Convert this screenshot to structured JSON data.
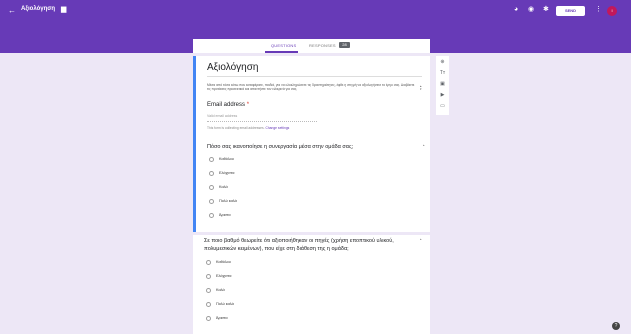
{
  "header": {
    "back_icon": "arrow-back-icon",
    "title": "Αξιολόγηση",
    "folder_icon": "folder-icon",
    "palette_icon": "palette-icon",
    "preview_icon": "eye-icon",
    "settings_icon": "gear-icon",
    "send_label": "SEND",
    "more_icon": "more-vert-icon",
    "avatar_letter": "Ι",
    "accent_color": "#673ab7"
  },
  "tabs": {
    "questions_label": "QUESTIONS",
    "responses_label": "RESPONSES",
    "responses_count": "28"
  },
  "form": {
    "title": "Αξιολόγηση",
    "description": "Μέσα από τόσα κάτω που καταφέρατε, παιδιά, για να ολοκληρώσετε τις δραστηριότητες, έφθε η στιγμή να αξιολογήσετε το έργο σας. Διαβάστε τις προτάσεις προσεκτικά και απαντήστε τον ειλικρινά για σας.",
    "email_label": "Email address",
    "email_required": "*",
    "email_placeholder": "Valid email address",
    "email_note": "This form is collecting email addresses.",
    "email_link": "Change settings"
  },
  "questions": [
    {
      "text": "Πόσο σας ικανοποίησε η συνεργασία μέσα στην ομάδα σας;",
      "options": [
        "Καθόλου",
        "Ελάχιστα",
        "Καλά",
        "Πολύ καλά",
        "Άριστα"
      ]
    },
    {
      "text": "Σε ποιο βαθμό θεωρείτε ότι αξιοποιήθηκαν οι πηγές (χρήση εποπτικού υλικού, πολυμεσικών κειμένων), που είχε στη διάθεση της η ομάδα;",
      "options": [
        "Καθόλου",
        "Ελάχιστα",
        "Καλά",
        "Πολύ καλά",
        "Άριστα"
      ]
    }
  ],
  "toolbar": {
    "add_question": "⊕",
    "add_title": "Tт",
    "add_image": "▣",
    "add_video": "▶",
    "add_section": "▭"
  },
  "help_label": "?"
}
